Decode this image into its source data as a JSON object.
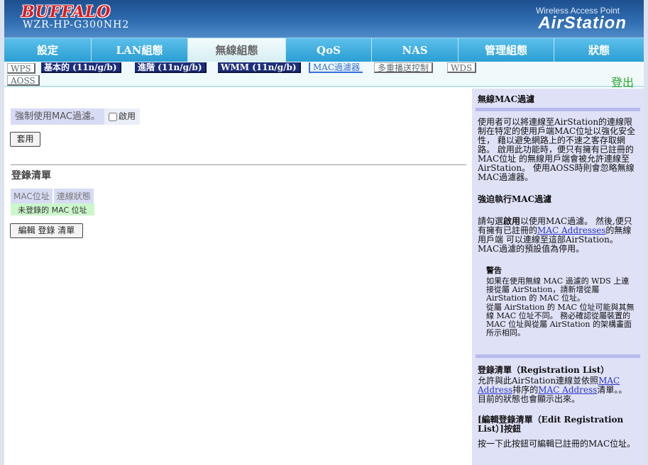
{
  "brand": {
    "logo": "BUFFALO",
    "model": "WZR-HP-G300NH2",
    "product_sub": "Wireless Access Point",
    "product_name": "AirStation"
  },
  "main_tabs": [
    {
      "label": "設定"
    },
    {
      "label": "LAN組態"
    },
    {
      "label": "無線組態"
    },
    {
      "label": "QoS"
    },
    {
      "label": "NAS"
    },
    {
      "label": "管理組態"
    },
    {
      "label": "狀態"
    }
  ],
  "sub_tabs": [
    {
      "label": "WPS"
    },
    {
      "label": "基本的 (11n/g/b)"
    },
    {
      "label": "進階 (11n/g/b)"
    },
    {
      "label": "WMM (11n/g/b)"
    },
    {
      "label": "MAC過濾器"
    },
    {
      "label": "多重播送控制"
    },
    {
      "label": "WDS"
    },
    {
      "label": "AOSS"
    }
  ],
  "logout_label": "登出",
  "content": {
    "force_mac_label": "強制使用MAC過濾。",
    "enable_label": "啟用",
    "apply_label": "套用",
    "reg_title": "登錄清單",
    "col_mac": "MAC位址",
    "col_status": "連線狀態",
    "unregistered": "未登錄的 MAC 位址",
    "edit_label": "編輯 登錄 清單"
  },
  "help": {
    "h1": "無線MAC過濾",
    "p1": "使用者可以將連線至AirStation的連線限制在特定的使用戶端MAC位址以強化安全性， 藉以避免網路上的不速之客存取網路。 啟用此功能時，便只有擁有已註冊的MAC位址 的無線用戶端會被允許連線至AirStation。 使用AOSS時則會忽略無線MAC過濾器。",
    "h2": "強迫執行MAC過濾",
    "p2a": "請勾選",
    "p2b": "啟用",
    "p2c": "以使用MAC過濾。 然後,便只有擁有已註冊的",
    "p2link": "MAC Addresses",
    "p2d": "的無線用戶端 可以連線至這部AirStation。 MAC過濾的預設值為停用。",
    "warn_title": "警告",
    "warn1": "如果在使用無線 MAC 過濾的 WDS 上連接從屬 AirStation，請新增從屬 AirStation 的 MAC 位址。",
    "warn2": "從屬 AirStation 的 MAC 位址可能與其無線 MAC 位址不同。 務必確認從屬裝置的 MAC 位址與從屬 AirStation 的架構畫面所示相同。",
    "h3": "登錄清單（Registration List）",
    "p3a": "允許與此AirStation連線並依照",
    "p3link1": "MAC Address",
    "p3b": "排序的",
    "p3link2": "MAC Address",
    "p3c": "清單。。 目前的狀態也會顯示出來。",
    "h4": "[編輯登錄清單（Edit Registration List）]按鈕",
    "p4": "按一下此按鈕可編輯已註冊的MAC位址。"
  },
  "colors": {
    "accent": "#1f8fc6",
    "header": "#2e6cb0",
    "help_bg": "#dfe1f7",
    "link": "#2a35c8"
  }
}
